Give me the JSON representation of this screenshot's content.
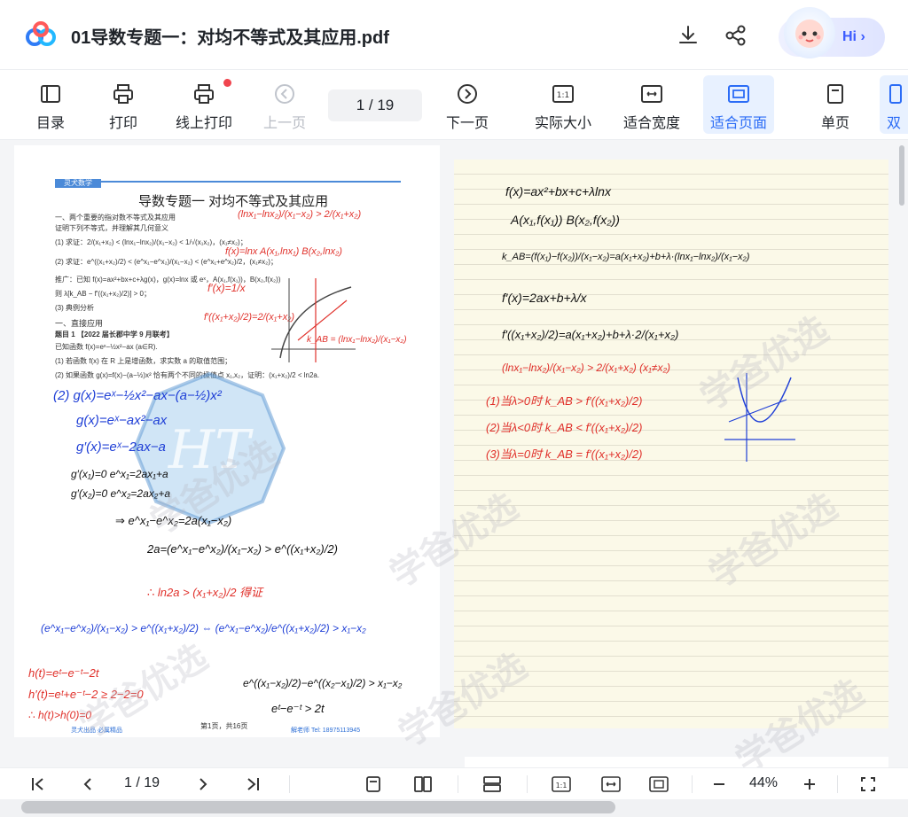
{
  "header": {
    "title": "01导数专题一：对均不等式及其应用.pdf",
    "hi_label": "Hi"
  },
  "toolbar": {
    "toc": "目录",
    "print": "打印",
    "online_print": "线上打印",
    "prev_page": "上一页",
    "page_indicator": "1  / 19",
    "next_page": "下一页",
    "actual_size": "实际大小",
    "fit_width": "适合宽度",
    "fit_page": "适合页面",
    "single_page": "单页",
    "double_page": "双"
  },
  "document": {
    "header_tag": "灵犬数学",
    "title": "导数专题一 对均不等式及其应用",
    "lines": [
      "一、两个重要的指对数不等式及其应用",
      "证明下列不等式，并理解其几何意义",
      "(1) 求证：2/(x₁+x₂) < (lnx₁−lnx₂)/(x₁−x₂) < 1/√(x₁x₂)，(x₁≠x₂)；",
      "(2) 求证：e^((x₁+x₂)/2) < (e^x₁−e^x₂)/(x₁−x₂) < (e^x₁+e^x₂)/2，(x₁≠x₂)；",
      "推广：已知 f(x)=ax²+bx+c+λg(x)，g(x)=lnx 或 eˣ，A(x₁,f(x₁))，B(x₂,f(x₂))",
      "则 λ[k_AB − f′((x₁+x₂)/2)] > 0；",
      "(3) 典例分析",
      "一、直接应用",
      "题目 1 【2022 届长郡中学 9 月联考】",
      "已知函数 f(x)=eˣ−½x²−ax (a∈R).",
      "(1) 若函数 f(x) 在 R 上是增函数，求实数 a 的取值范围；",
      "(2) 如果函数 g(x)=f(x)−(a−½)x² 恰有两个不同的极值点 x₁,x₂，证明：(x₁+x₂)/2 < ln2a."
    ],
    "footer_page": "第1页，共16页",
    "footer_left": "灵犬出品  必属精品",
    "footer_right": "解老师 Tel: 18975113945"
  },
  "handwriting": {
    "left": [
      "(lnx₁−lnx₂)/(x₁−x₂) > 2/(x₁+x₂)",
      "f(x)=lnx   A(x₁,lnx₁)  B(x₂,lnx₂)",
      "f′(x)=1/x",
      "f′((x₁+x₂)/2)=2/(x₁+x₂)",
      "k_AB = (lnx₁−lnx₂)/(x₁−x₂)",
      "(2) g(x)=eˣ−½x²−ax−(a−½)x²",
      "g(x)=eˣ−ax²−ax",
      "g′(x)=eˣ−2ax−a",
      "g′(x₁)=0   e^x₁=2ax₁+a",
      "g′(x₂)=0   e^x₂=2ax₂+a",
      "⇒ e^x₁−e^x₂=2a(x₁−x₂)",
      "2a=(e^x₁−e^x₂)/(x₁−x₂) > e^((x₁+x₂)/2)",
      "∴ ln2a > (x₁+x₂)/2 得证",
      "(e^x₁−e^x₂)/(x₁−x₂) > e^((x₁+x₂)/2)  ⇔  (e^x₁−e^x₂)/e^((x₁+x₂)/2) > x₁−x₂",
      "h(t)=eᵗ−e⁻ᵗ−2t",
      "h′(t)=eᵗ+e⁻ᵗ−2 ≥ 2−2=0",
      "∴ h(t)>h(0)=0",
      "e^((x₁−x₂)/2)−e^((x₂−x₁)/2) > x₁−x₂",
      "eᵗ−e⁻ᵗ > 2t"
    ],
    "right": [
      "f(x)=ax²+bx+c+λlnx",
      "A(x₁,f(x₁))   B(x₂,f(x₂))",
      "k_AB=(f(x₁)−f(x₂))/(x₁−x₂)=a(x₁+x₂)+b+λ·(lnx₁−lnx₂)/(x₁−x₂)",
      "f′(x)=2ax+b+λ/x",
      "f′((x₁+x₂)/2)=a(x₁+x₂)+b+λ·2/(x₁+x₂)",
      "(lnx₁−lnx₂)/(x₁−x₂) > 2/(x₁+x₂)   (x₁≠x₂)",
      "(1)当λ>0时  k_AB > f′((x₁+x₂)/2)",
      "(2)当λ<0时  k_AB < f′((x₁+x₂)/2)",
      "(3)当λ=0时  k_AB = f′((x₁+x₂)/2)"
    ]
  },
  "watermark": "学爸优选",
  "bottom": {
    "page_indicator": "1  / 19",
    "zoom": "44%"
  }
}
